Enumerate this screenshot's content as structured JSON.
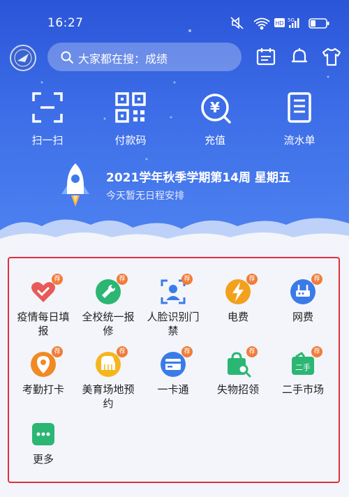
{
  "status_bar": {
    "time": "16:27",
    "icons": [
      "mute-icon",
      "wifi-icon",
      "hd-icon",
      "signal-5g-icon",
      "battery-icon"
    ]
  },
  "header": {
    "logo": "school-logo",
    "search": {
      "text": "大家都在搜：成绩"
    },
    "icons": [
      "calendar-icon",
      "bell-icon",
      "shirt-icon"
    ]
  },
  "quick_actions": [
    {
      "label": "扫一扫",
      "icon": "scan-icon"
    },
    {
      "label": "付款码",
      "icon": "qr-code-icon"
    },
    {
      "label": "充值",
      "icon": "recharge-icon"
    },
    {
      "label": "流水单",
      "icon": "bill-icon"
    }
  ],
  "schedule": {
    "date_line": "2021学年秋季学期第14周 星期五",
    "message": "今天暂无日程安排"
  },
  "services": [
    {
      "label": "疫情每日填报",
      "icon": "heart-icon",
      "badge": "荐",
      "color": "#e85a5a"
    },
    {
      "label": "全校统一报修",
      "icon": "wrench-icon",
      "badge": "荐",
      "color": "#2bb673"
    },
    {
      "label": "人脸识别门禁",
      "icon": "face-icon",
      "badge": "荐",
      "color": "#3a7be8"
    },
    {
      "label": "电费",
      "icon": "lightning-icon",
      "badge": "荐",
      "color": "#f3a11d"
    },
    {
      "label": "网费",
      "icon": "router-icon",
      "badge": "荐",
      "color": "#3a7be8"
    },
    {
      "label": "考勤打卡",
      "icon": "location-clock-icon",
      "badge": "荐",
      "color": "#f08a24"
    },
    {
      "label": "美育场地预约",
      "icon": "piano-icon",
      "badge": "荐",
      "color": "#f5b51d"
    },
    {
      "label": "一卡通",
      "icon": "card-icon",
      "badge": "荐",
      "color": "#3a7be8"
    },
    {
      "label": "失物招领",
      "icon": "bag-search-icon",
      "badge": "荐",
      "color": "#2bb673"
    },
    {
      "label": "二手市场",
      "icon": "second-hand-icon",
      "badge": "荐",
      "color": "#2bb673"
    },
    {
      "label": "更多",
      "icon": "more-icon",
      "badge": "",
      "color": "#2bb673"
    }
  ]
}
